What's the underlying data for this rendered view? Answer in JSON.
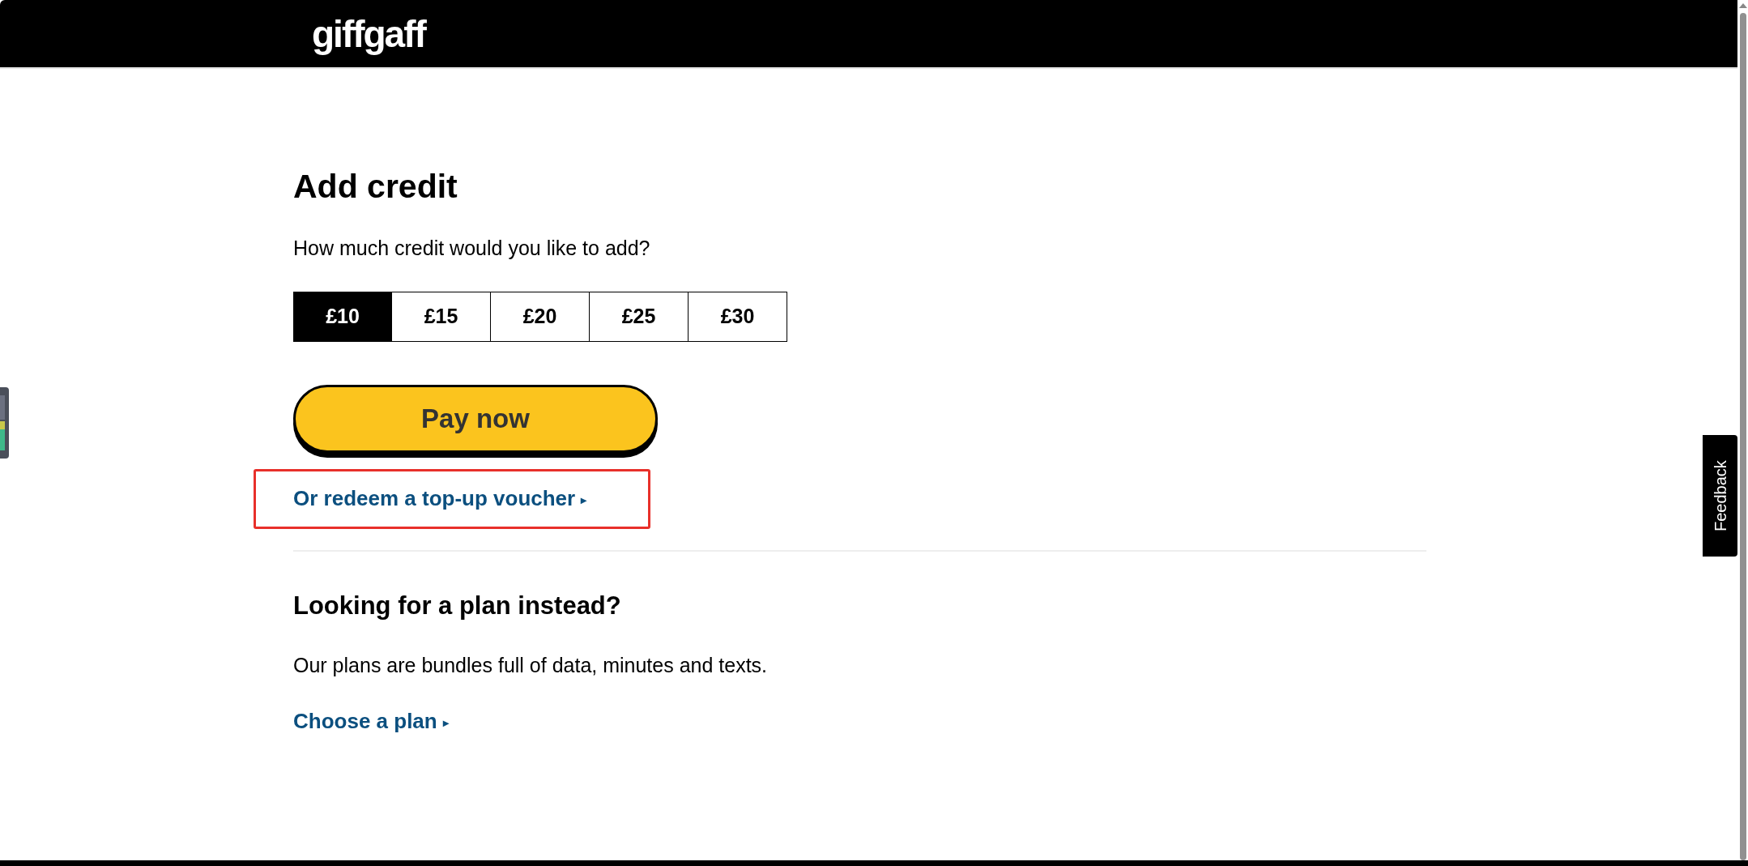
{
  "header": {
    "logo": "giffgaff"
  },
  "title": "Add credit",
  "question": "How much credit would you like to add?",
  "amounts": [
    {
      "label": "£10",
      "selected": true
    },
    {
      "label": "£15",
      "selected": false
    },
    {
      "label": "£20",
      "selected": false
    },
    {
      "label": "£25",
      "selected": false
    },
    {
      "label": "£30",
      "selected": false
    }
  ],
  "pay_button": "Pay now",
  "voucher_link": {
    "label": "Or redeem a top-up voucher",
    "arrow": "▸",
    "highlighted": true
  },
  "plan_section": {
    "heading": "Looking for a plan instead?",
    "text": "Our plans are bundles full of data, minutes and texts.",
    "link": {
      "label": "Choose a plan",
      "arrow": "▸"
    }
  },
  "feedback_tab": "Feedback"
}
